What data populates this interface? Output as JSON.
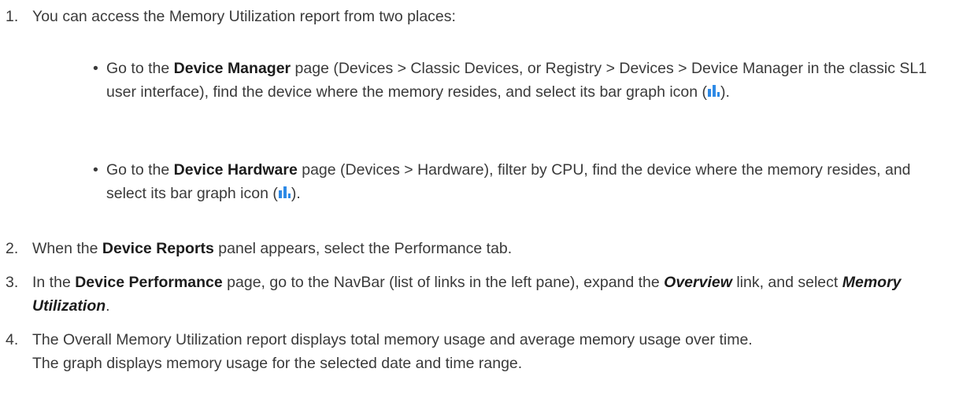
{
  "steps": [
    {
      "number": "1.",
      "text": "You can access the Memory Utilization report from two places:",
      "bullets": [
        {
          "pre": "Go to the ",
          "bold": "Device Manager",
          "post": " page (Devices > Classic Devices, or Registry > Devices > Device Manager in the classic SL1 user interface), find the device where the memory resides, and select its bar graph icon (",
          "end": ")."
        },
        {
          "pre": "Go to the ",
          "bold": "Device Hardware",
          "post": " page (Devices > Hardware), filter by CPU, find the device where the memory resides, and select its bar graph icon (",
          "end": ")."
        }
      ]
    },
    {
      "number": "2.",
      "pre": "When the ",
      "bold": "Device Reports",
      "post": " panel appears, select the Performance tab."
    },
    {
      "number": "3.",
      "pre": "In the ",
      "bold": "Device Performance",
      "mid": " page, go to the NavBar (list of links in the left pane), expand the ",
      "bold_italic_1": "Overview",
      "mid2": " link, and select ",
      "bold_italic_2": "Memory Utilization",
      "end": "."
    },
    {
      "number": "4.",
      "line1": "The Overall Memory Utilization report displays total memory usage and average memory usage over time.",
      "line2": "The graph displays memory usage for the selected date and time range."
    }
  ],
  "bullet_char": "•",
  "icon": {
    "name": "bar-graph-icon",
    "color": "#2e8ae6"
  }
}
